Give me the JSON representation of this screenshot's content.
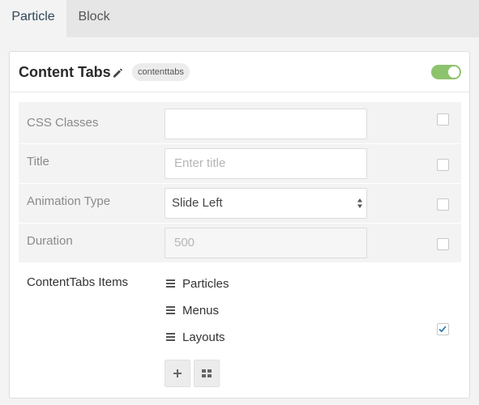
{
  "tabs": [
    {
      "label": "Particle",
      "active": true
    },
    {
      "label": "Block",
      "active": false
    }
  ],
  "header": {
    "title": "Content Tabs",
    "badge": "contenttabs",
    "toggle_on": true,
    "edit_icon": "pencil-icon"
  },
  "fields": {
    "css_classes": {
      "label": "CSS Classes",
      "value": ""
    },
    "title": {
      "label": "Title",
      "value": "",
      "placeholder": "Enter title"
    },
    "animation_type": {
      "label": "Animation Type",
      "value": "Slide Left"
    },
    "duration": {
      "label": "Duration",
      "value": "500"
    }
  },
  "items_section": {
    "label": "ContentTabs Items",
    "items": [
      "Particles",
      "Menus",
      "Layouts"
    ],
    "checked": true,
    "add_icon": "plus-icon",
    "grid_icon": "grid-icon"
  },
  "colors": {
    "accent": "#8ec36d",
    "active_tab_text": "#2e4757",
    "checkmark": "#2a7ab0"
  }
}
